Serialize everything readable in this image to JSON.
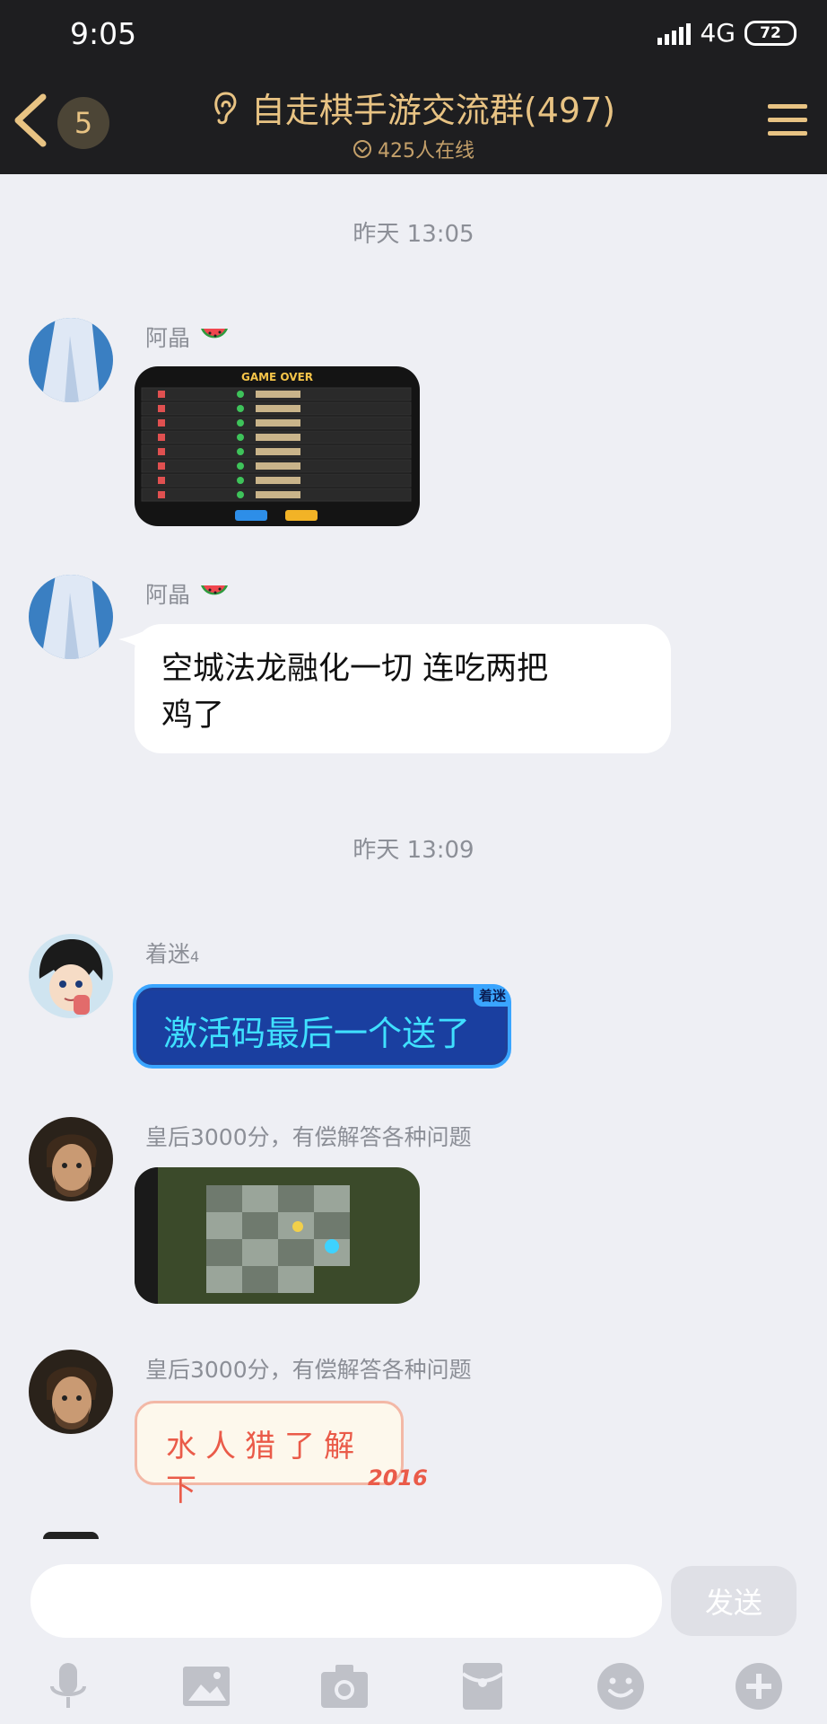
{
  "status_bar": {
    "time": "9:05",
    "network": "4G",
    "battery": "72"
  },
  "header": {
    "unread_count": "5",
    "title": "自走棋手游交流群(497)",
    "online": "425人在线"
  },
  "messages": {
    "timestamp_1": "昨天 13:05",
    "m1_sender": "阿晶",
    "m2_sender": "阿晶",
    "m2_text_line1": "空城法龙融化一切  连吃两把",
    "m2_text_line2": "鸡了",
    "timestamp_2": "昨天 13:09",
    "m3_sender": "着迷",
    "m3_sender_suffix": "4",
    "m3_text": "激活码最后一个送了",
    "m3_tag": "着迷",
    "m4_sender": "皇后3000分，有偿解答各种问题",
    "m5_sender": "皇后3000分，有偿解答各种问题",
    "m5_sticker_text": "水人猎了解下",
    "m5_sticker_year": "2016",
    "m1_image_title": "GAME OVER"
  },
  "composer": {
    "placeholder": "",
    "send_label": "发送"
  },
  "toolbar": [
    "microphone-icon",
    "image-icon",
    "camera-icon",
    "red-packet-icon",
    "emoji-icon",
    "plus-icon"
  ],
  "colors": {
    "header_bg": "#1e1e20",
    "gold": "#e8c383",
    "chat_bg": "#eeeff4",
    "blue_bubble": "#1a3fa0"
  }
}
